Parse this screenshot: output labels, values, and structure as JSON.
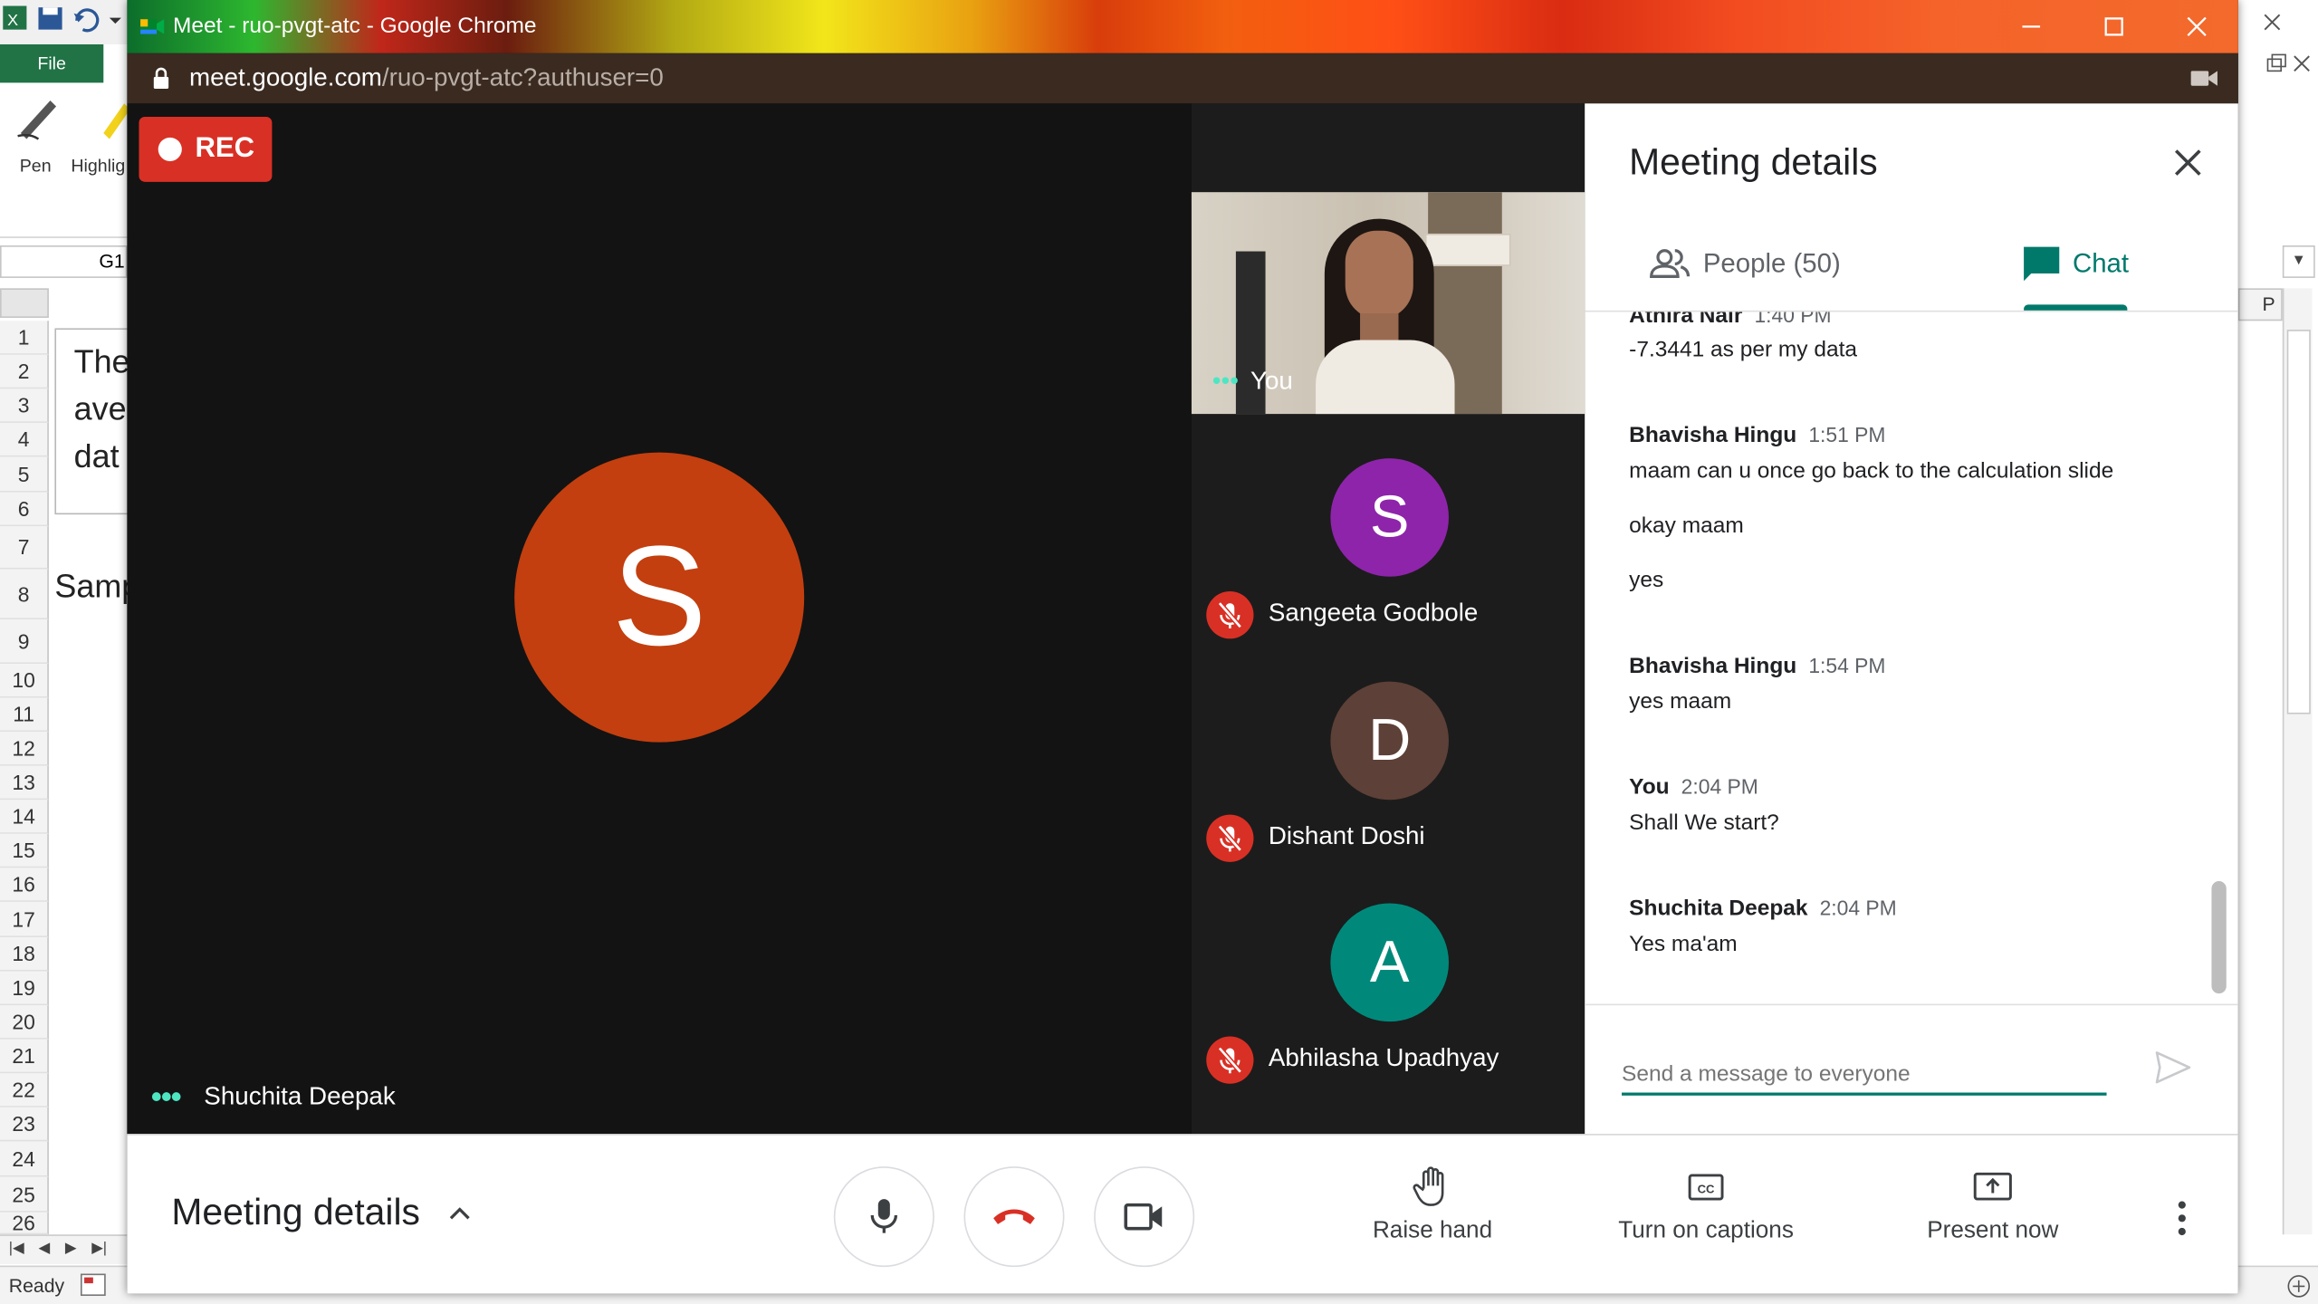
{
  "excel": {
    "file_tab": "File",
    "tools": [
      "Pen",
      "Highlig"
    ],
    "name_box": "G1",
    "right_col_header": "P",
    "row_numbers": [
      "1",
      "2",
      "3",
      "4",
      "5",
      "6",
      "7",
      "8",
      "9",
      "10",
      "11",
      "12",
      "13",
      "14",
      "15",
      "16",
      "17",
      "18",
      "19",
      "20",
      "21",
      "22",
      "23",
      "24",
      "25",
      "26"
    ],
    "textbox_lines": [
      "The",
      "ave",
      "dat"
    ],
    "cell_text": "Samp",
    "status": "Ready"
  },
  "chrome": {
    "title": "Meet - ruo-pvgt-atc - Google Chrome",
    "url_host": "meet.google.com",
    "url_path": "/ruo-pvgt-atc?authuser=0"
  },
  "meet": {
    "rec_label": "REC",
    "main_speaker": {
      "initial": "S",
      "name": "Shuchita Deepak",
      "color": "#c33f0f"
    },
    "self_label": "You",
    "participants": [
      {
        "initial": "S",
        "name": "Sangeeta Godbole",
        "color": "#8e24aa"
      },
      {
        "initial": "D",
        "name": "Dishant Doshi",
        "color": "#5d4037"
      },
      {
        "initial": "A",
        "name": "Abhilasha Upadhyay",
        "color": "#00897b"
      }
    ],
    "panel": {
      "title": "Meeting details",
      "tab_people": "People (50)",
      "tab_chat": "Chat",
      "messages": [
        {
          "sender": "Athira Nair",
          "time": "1:40 PM",
          "lines": [
            "-7.3441 as per my data"
          ]
        },
        {
          "sender": "Bhavisha Hingu",
          "time": "1:51 PM",
          "lines": [
            "maam can u once go back to the calculation slide",
            "okay maam",
            "yes"
          ]
        },
        {
          "sender": "Bhavisha Hingu",
          "time": "1:54 PM",
          "lines": [
            "yes maam"
          ]
        },
        {
          "sender": "You",
          "time": "2:04 PM",
          "lines": [
            "Shall We start?"
          ]
        },
        {
          "sender": "Shuchita Deepak",
          "time": "2:04 PM",
          "lines": [
            "Yes ma'am"
          ]
        }
      ],
      "input_placeholder": "Send a message to everyone"
    },
    "bottom": {
      "meeting_details": "Meeting details",
      "raise_hand": "Raise hand",
      "captions": "Turn on captions",
      "present": "Present now"
    },
    "colors": {
      "accent": "#00796b",
      "danger": "#d93025",
      "speaking": "#4ee6c2"
    }
  }
}
